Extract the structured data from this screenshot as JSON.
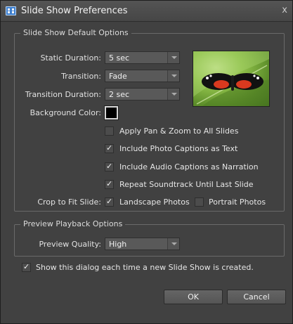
{
  "window": {
    "title": "Slide Show Preferences",
    "close_label": "x"
  },
  "default_options": {
    "legend": "Slide Show Default Options",
    "static_duration": {
      "label": "Static Duration:",
      "value": "5 sec"
    },
    "transition": {
      "label": "Transition:",
      "value": "Fade"
    },
    "transition_duration": {
      "label": "Transition Duration:",
      "value": "2 sec"
    },
    "background_color": {
      "label": "Background Color:",
      "value": "#000000"
    },
    "apply_pan_zoom": {
      "label": "Apply Pan & Zoom to All Slides",
      "checked": false
    },
    "photo_captions": {
      "label": "Include Photo Captions as Text",
      "checked": true
    },
    "audio_captions": {
      "label": "Include Audio Captions as Narration",
      "checked": true
    },
    "repeat_soundtrack": {
      "label": "Repeat Soundtrack Until Last Slide",
      "checked": true
    },
    "crop": {
      "label": "Crop to Fit Slide:",
      "landscape": {
        "label": "Landscape Photos",
        "checked": true
      },
      "portrait": {
        "label": "Portrait Photos",
        "checked": false
      }
    }
  },
  "preview_options": {
    "legend": "Preview Playback Options",
    "quality": {
      "label": "Preview Quality:",
      "value": "High"
    }
  },
  "show_dialog": {
    "label": "Show this dialog each time a new Slide Show is created.",
    "checked": true
  },
  "buttons": {
    "ok": "OK",
    "cancel": "Cancel"
  }
}
